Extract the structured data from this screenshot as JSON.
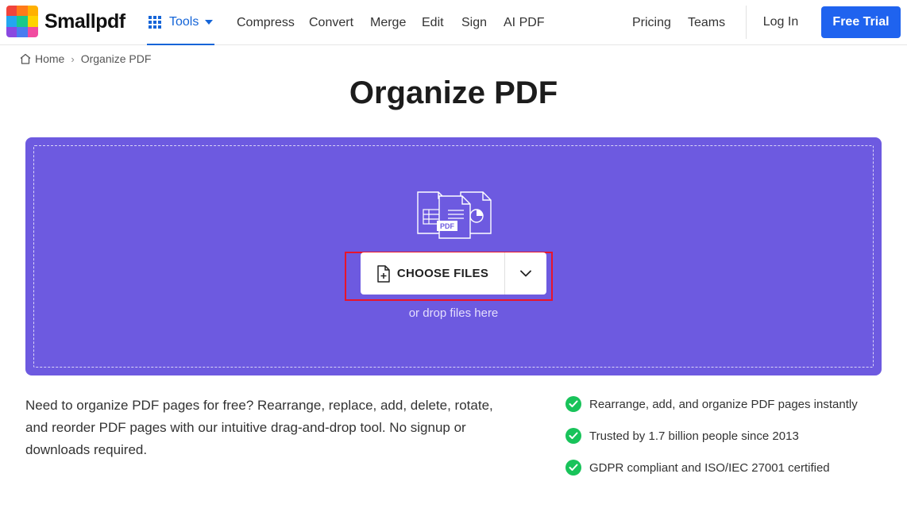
{
  "brand": {
    "name": "Smallpdf",
    "logo_colors": [
      "#f0443c",
      "#ff7a1a",
      "#ffb000",
      "#22a6f0",
      "#19c98a",
      "#ffd200",
      "#8a48e0",
      "#4a7cf0",
      "#f14ba0"
    ]
  },
  "header": {
    "tools_label": "Tools",
    "nav": [
      "Compress",
      "Convert",
      "Merge",
      "Edit",
      "Sign",
      "AI PDF"
    ],
    "right_nav": [
      "Pricing",
      "Teams"
    ],
    "login_label": "Log In",
    "trial_label": "Free Trial"
  },
  "breadcrumb": {
    "home": "Home",
    "current": "Organize PDF"
  },
  "page": {
    "title": "Organize PDF"
  },
  "dropzone": {
    "art_badge": "PDF",
    "choose_label": "CHOOSE FILES",
    "drop_hint": "or drop files here"
  },
  "description": "Need to organize PDF pages for free? Rearrange, replace, add, delete, rotate, and reorder PDF pages with our intuitive drag-and-drop tool. No signup or downloads required.",
  "features": [
    "Rearrange, add, and organize PDF pages instantly",
    "Trusted by 1.7 billion people since 2013",
    "GDPR compliant and ISO/IEC 27001 certified"
  ],
  "colors": {
    "accent": "#1f63ef",
    "dropzone": "#6d5ae0",
    "check": "#18c35a",
    "highlight": "#e8142b"
  }
}
